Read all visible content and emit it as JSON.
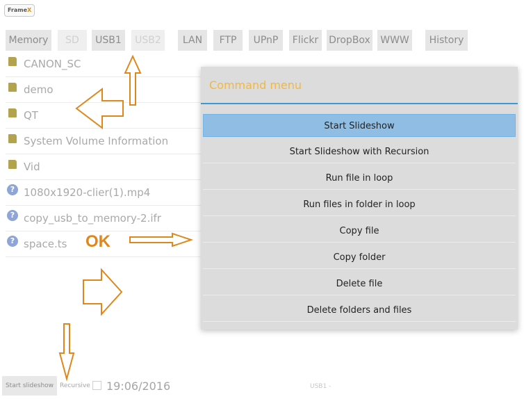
{
  "logo": {
    "text_main": "Frame",
    "text_accent": "X"
  },
  "tabs": [
    {
      "label": "Memory",
      "disabled": false
    },
    {
      "label": "SD",
      "disabled": true
    },
    {
      "label": "USB1",
      "disabled": false
    },
    {
      "label": "USB2",
      "disabled": true
    },
    {
      "label": "LAN",
      "disabled": false
    },
    {
      "label": "FTP",
      "disabled": false
    },
    {
      "label": "UPnP",
      "disabled": false
    },
    {
      "label": "Flickr",
      "disabled": false
    },
    {
      "label": "DropBox",
      "disabled": false
    },
    {
      "label": "WWW",
      "disabled": false
    },
    {
      "label": "History",
      "disabled": false
    }
  ],
  "files": [
    {
      "name": "CANON_SC",
      "type": "folder"
    },
    {
      "name": "demo",
      "type": "folder"
    },
    {
      "name": "QT",
      "type": "folder"
    },
    {
      "name": "System Volume Information",
      "type": "folder"
    },
    {
      "name": "Vid",
      "type": "folder"
    },
    {
      "name": "1080x1920-clier(1).mp4",
      "type": "file"
    },
    {
      "name": "copy_usb_to_memory-2.ifr",
      "type": "file"
    },
    {
      "name": "space.ts",
      "type": "file"
    }
  ],
  "dialog": {
    "title": "Command menu",
    "commands": [
      {
        "label": "Start Slideshow",
        "selected": true
      },
      {
        "label": "Start Slideshow with Recursion",
        "selected": false
      },
      {
        "label": "Run file in loop",
        "selected": false
      },
      {
        "label": "Run files in folder in loop",
        "selected": false
      },
      {
        "label": "Copy file",
        "selected": false
      },
      {
        "label": "Copy folder",
        "selected": false
      },
      {
        "label": "Delete file",
        "selected": false
      },
      {
        "label": "Delete folders and files",
        "selected": false
      }
    ]
  },
  "bottom": {
    "start_button": "Start slideshow",
    "recursive_label": "Recursive",
    "date": "19:06/2016",
    "status": "USB1 -"
  },
  "annotation": {
    "ok_text": "OK"
  },
  "colors": {
    "accent_title": "#f4b73b",
    "header_line": "#3b98d5",
    "annotation": "#e0871b",
    "selected_command": "#8fbde3"
  }
}
